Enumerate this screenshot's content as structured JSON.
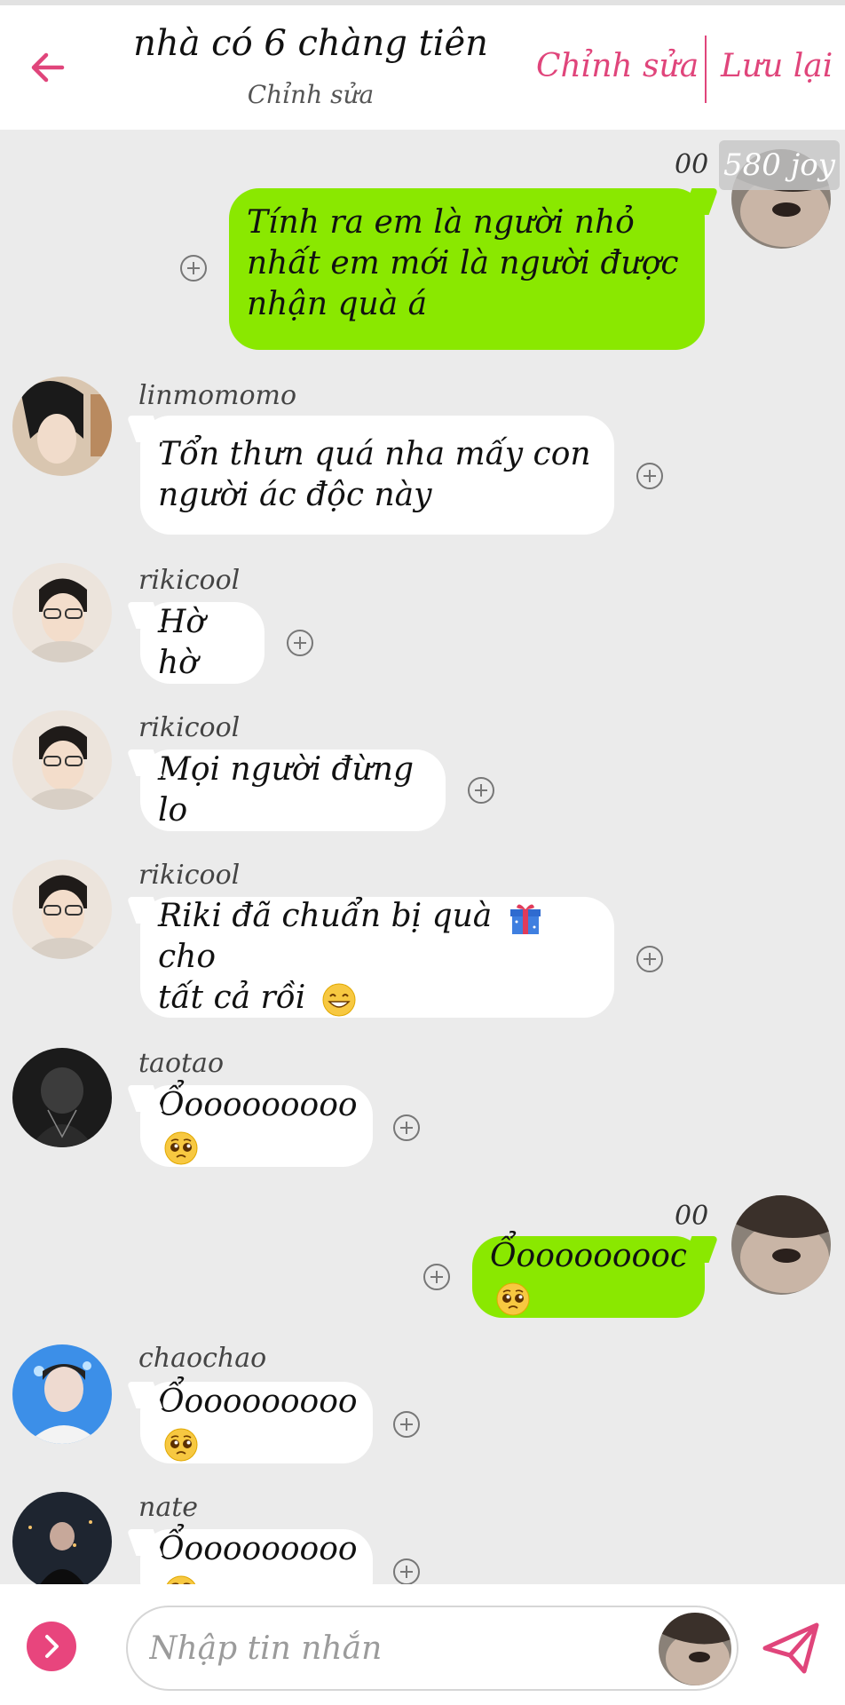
{
  "header": {
    "title": "nhà có 6 chàng tiên",
    "subtitle": "Chỉnh sửa",
    "edit_label": "Chỉnh sửa",
    "save_label": "Lưu lại"
  },
  "chat": {
    "badge": "580 joy",
    "messages": [
      {
        "side": "out",
        "sender": "00",
        "text_lines": [
          "Tính ra em là người nhỏ",
          "nhất em mới là người được",
          "nhận quà á"
        ]
      },
      {
        "side": "in",
        "sender": "linmomomo",
        "text_lines": [
          "Tổn thưn quá nha mấy con",
          "người ác độc này"
        ]
      },
      {
        "side": "in",
        "sender": "rikicool",
        "text_lines": [
          "Hờ hờ"
        ]
      },
      {
        "side": "in",
        "sender": "rikicool",
        "text_lines": [
          "Mọi người đừng lo"
        ]
      },
      {
        "side": "in",
        "sender": "rikicool",
        "text_lines": [
          "Riki đã chuẩn bị quà",
          "cho",
          "tất cả rồi"
        ]
      },
      {
        "side": "in",
        "sender": "taotao",
        "text_lines": [
          "Ổooooooooo"
        ]
      },
      {
        "side": "out",
        "sender": "00",
        "text_lines": [
          "Ổooooooooo"
        ]
      },
      {
        "side": "in",
        "sender": "chaochao",
        "text_lines": [
          "Ổooooooooo"
        ]
      },
      {
        "side": "in",
        "sender": "nate",
        "text_lines": [
          "Ổooooooooo"
        ]
      }
    ]
  },
  "input": {
    "placeholder": "Nhập tin nhắn"
  },
  "icons": {
    "back": "arrow-left-icon",
    "plus": "plus-circle-icon",
    "send": "paper-plane-icon",
    "more": "chevron-right-icon",
    "gift": "gift-emoji",
    "grin": "grinning-emoji",
    "pleading": "pleading-face-emoji"
  },
  "colors": {
    "accent": "#e0457b",
    "out_bubble": "#8ae800",
    "in_bubble": "#ffffff",
    "background": "#ebebeb"
  }
}
